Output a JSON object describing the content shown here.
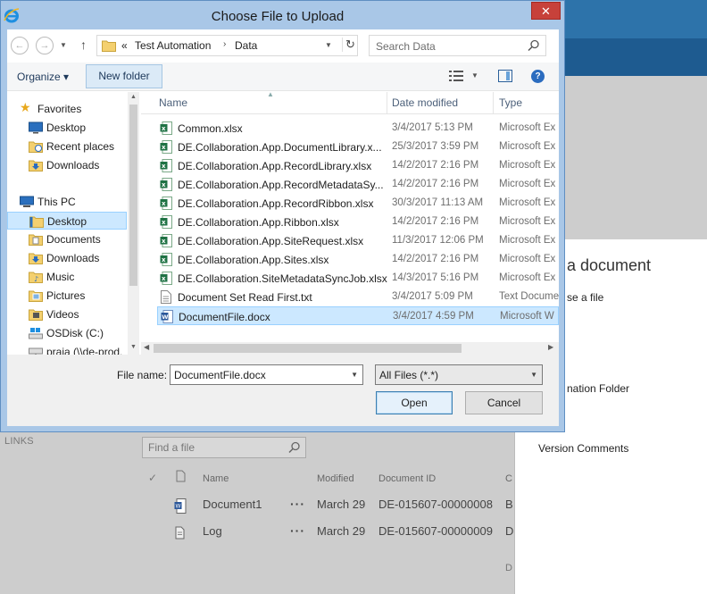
{
  "dialog": {
    "title": "Choose File to Upload",
    "close_label": "✕",
    "address": {
      "prefix": "«",
      "crumbs": [
        "Test Automation",
        "Data"
      ]
    },
    "search_placeholder": "Search Data",
    "toolbar": {
      "organize": "Organize ▾",
      "new_folder": "New folder"
    },
    "nav": {
      "favorites": "Favorites",
      "favorite_items": [
        "Desktop",
        "Recent places",
        "Downloads"
      ],
      "this_pc": "This PC",
      "pc_items": [
        "Desktop",
        "Documents",
        "Downloads",
        "Music",
        "Pictures",
        "Videos",
        "OSDisk (C:)",
        "praja (\\\\de-prod."
      ]
    },
    "columns": {
      "name": "Name",
      "date": "Date modified",
      "type": "Type"
    },
    "files": [
      {
        "name": "Common.xlsx",
        "date": "3/4/2017 5:13 PM",
        "type": "Microsoft Ex",
        "icon": "excel-icon"
      },
      {
        "name": "DE.Collaboration.App.DocumentLibrary.x...",
        "date": "25/3/2017 3:59 PM",
        "type": "Microsoft Ex",
        "icon": "excel-icon"
      },
      {
        "name": "DE.Collaboration.App.RecordLibrary.xlsx",
        "date": "14/2/2017 2:16 PM",
        "type": "Microsoft Ex",
        "icon": "excel-icon"
      },
      {
        "name": "DE.Collaboration.App.RecordMetadataSy...",
        "date": "14/2/2017 2:16 PM",
        "type": "Microsoft Ex",
        "icon": "excel-icon"
      },
      {
        "name": "DE.Collaboration.App.RecordRibbon.xlsx",
        "date": "30/3/2017 11:13 AM",
        "type": "Microsoft Ex",
        "icon": "excel-icon"
      },
      {
        "name": "DE.Collaboration.App.Ribbon.xlsx",
        "date": "14/2/2017 2:16 PM",
        "type": "Microsoft Ex",
        "icon": "excel-icon"
      },
      {
        "name": "DE.Collaboration.App.SiteRequest.xlsx",
        "date": "11/3/2017 12:06 PM",
        "type": "Microsoft Ex",
        "icon": "excel-icon"
      },
      {
        "name": "DE.Collaboration.App.Sites.xlsx",
        "date": "14/2/2017 2:16 PM",
        "type": "Microsoft Ex",
        "icon": "excel-icon"
      },
      {
        "name": "DE.Collaboration.SiteMetadataSyncJob.xlsx",
        "date": "14/3/2017 5:16 PM",
        "type": "Microsoft Ex",
        "icon": "excel-icon"
      },
      {
        "name": "Document Set Read First.txt",
        "date": "3/4/2017 5:09 PM",
        "type": "Text Docume",
        "icon": "text-file-icon"
      },
      {
        "name": "DocumentFile.docx",
        "date": "3/4/2017 4:59 PM",
        "type": "Microsoft W",
        "icon": "word-icon"
      }
    ],
    "file_name_label": "File name:",
    "file_name_value": "DocumentFile.docx",
    "file_type_value": "All Files (*.*)",
    "open_label": "Open",
    "cancel_label": "Cancel"
  },
  "background": {
    "links_label": "LINKS",
    "search_placeholder": "Find a file",
    "columns": {
      "name": "Name",
      "modified": "Modified",
      "doc_id": "Document ID",
      "extra": "C"
    },
    "rows": [
      {
        "name": "Document1",
        "modified": "March 29",
        "doc_id": "DE-015607-00000008",
        "extra": "B"
      },
      {
        "name": "Log",
        "modified": "March 29",
        "doc_id": "DE-015607-00000009",
        "extra": "D"
      }
    ],
    "footer_cut": "D",
    "panel": {
      "title": "a document",
      "subtitle": "se a file",
      "folder_label": "nation Folder",
      "version_label": "Version Comments"
    }
  },
  "colors": {
    "accent": "#2d73aa",
    "selection": "#cce8ff",
    "close": "#c7413a"
  }
}
